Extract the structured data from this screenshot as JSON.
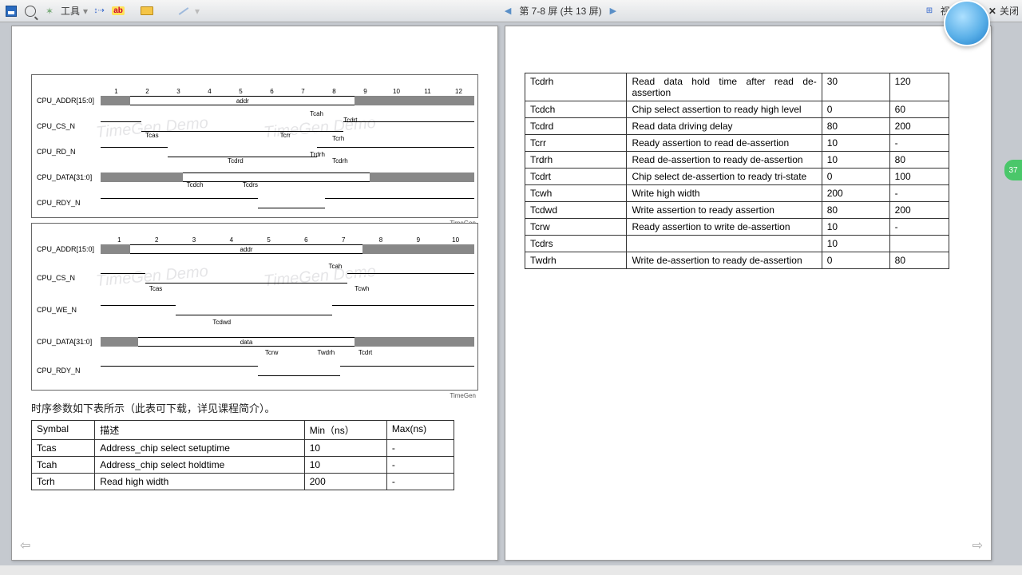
{
  "toolbar": {
    "tools_label": "工具",
    "nav_text": "第 7-8 屏 (共 13 屏)",
    "view_label": "视",
    "close_label": "关闭"
  },
  "diagram1": {
    "ticks": [
      "1",
      "2",
      "3",
      "4",
      "5",
      "6",
      "7",
      "8",
      "9",
      "10",
      "11",
      "12"
    ],
    "signals": [
      "CPU_ADDR[15:0]",
      "CPU_CS_N",
      "CPU_RD_N",
      "CPU_DATA[31:0]",
      "CPU_RDY_N"
    ],
    "annots": {
      "tcas": "Tcas",
      "tcah": "Tcah",
      "tcrr": "Tcrr",
      "tcdrt": "Tcdrt",
      "tcrh": "Tcrh",
      "tcdrd": "Tcdrd",
      "tcdrh": "Tcdrh",
      "tcdrs": "Tcdrs",
      "tcdch": "Tcdch",
      "trdrh": "Trdrh"
    },
    "addr_label": "addr",
    "footer": "TimeGen"
  },
  "diagram2": {
    "ticks": [
      "1",
      "2",
      "3",
      "4",
      "5",
      "6",
      "7",
      "8",
      "9",
      "10"
    ],
    "signals": [
      "CPU_ADDR[15:0]",
      "CPU_CS_N",
      "CPU_WE_N",
      "CPU_DATA[31:0]",
      "CPU_RDY_N"
    ],
    "annots": {
      "tcas": "Tcas",
      "tcah": "Tcah",
      "tcdwd": "Tcdwd",
      "tcrw": "Tcrw",
      "twdrh": "Twdrh",
      "tcwh": "Tcwh",
      "tcdrt": "Tcdrt"
    },
    "addr_label": "addr",
    "data_label": "data",
    "footer": "TimeGen"
  },
  "watermark": "TimeGen Demo",
  "para_caption": "时序参数如下表所示（此表可下载，详见课程简介）。",
  "table_left": {
    "headers": [
      "Symbal",
      "描述",
      "Min（ns）",
      "Max(ns)"
    ],
    "rows": [
      [
        "Tcas",
        "Address_chip select setuptime",
        "10",
        "-"
      ],
      [
        "Tcah",
        "Address_chip select holdtime",
        "10",
        "-"
      ],
      [
        "Tcrh",
        "Read high width",
        "200",
        "-"
      ]
    ]
  },
  "table_right": {
    "rows": [
      [
        "Tcdrh",
        "Read data hold time after read de-assertion",
        "30",
        "120"
      ],
      [
        "Tcdch",
        "Chip select assertion to ready high level",
        "0",
        "60"
      ],
      [
        "Tcdrd",
        "Read data driving delay",
        "80",
        "200"
      ],
      [
        "Tcrr",
        "Ready assertion to read de-assertion",
        "10",
        "-"
      ],
      [
        "Trdrh",
        "Read de-assertion to ready de-assertion",
        "10",
        "80"
      ],
      [
        "Tcdrt",
        "Chip select de-assertion to ready tri-state",
        "0",
        "100"
      ],
      [
        "Tcwh",
        "Write high width",
        "200",
        "-"
      ],
      [
        "Tcdwd",
        "Write assertion to ready assertion",
        "80",
        "200"
      ],
      [
        "Tcrw",
        "Ready assertion to write de-assertion",
        "10",
        "-"
      ],
      [
        "Tcdrs",
        "",
        "10",
        ""
      ],
      [
        "Twdrh",
        "Write de-assertion to ready de-assertion",
        "0",
        "80"
      ]
    ]
  },
  "badge": "37"
}
